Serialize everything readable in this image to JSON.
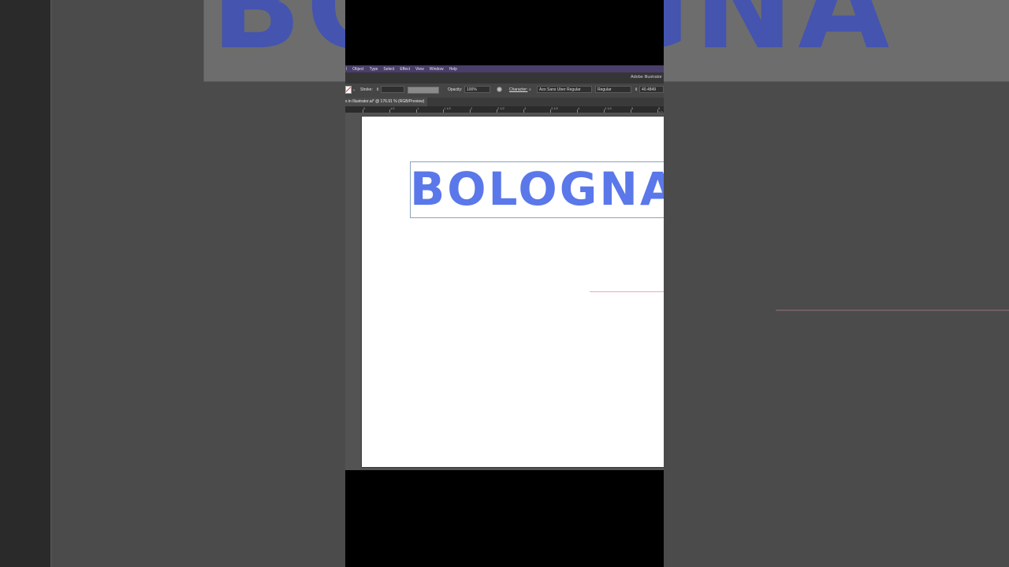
{
  "background": {
    "artwork_text": "BOLOGNA"
  },
  "app": {
    "title": "Adobe Illustrator",
    "menu": [
      "l",
      "Object",
      "Type",
      "Select",
      "Effect",
      "View",
      "Window",
      "Help"
    ],
    "control_bar": {
      "stroke_label": "Stroke:",
      "opacity_label": "Opacity:",
      "opacity_value": "100%",
      "character_label": "Character:",
      "font_family": "Azo Sans Uber Regular",
      "font_style": "Regular",
      "font_size": "40.4849"
    },
    "document_tab": "s in Illustrator.ai* @ 176.91 % (RGB/Preview)",
    "ruler_labels": [
      "0",
      "1/2",
      "1",
      "1 1/2",
      "2",
      "2 1/2",
      "3",
      "3 1/2",
      "4",
      "4 1/2",
      "5",
      "5 1/2"
    ],
    "artboard": {
      "text": "BOLOGNA"
    }
  },
  "colors": {
    "menubar": "#4a3e6a",
    "text_fill": "#5a78ea",
    "background_text": "#3a4fc0"
  }
}
